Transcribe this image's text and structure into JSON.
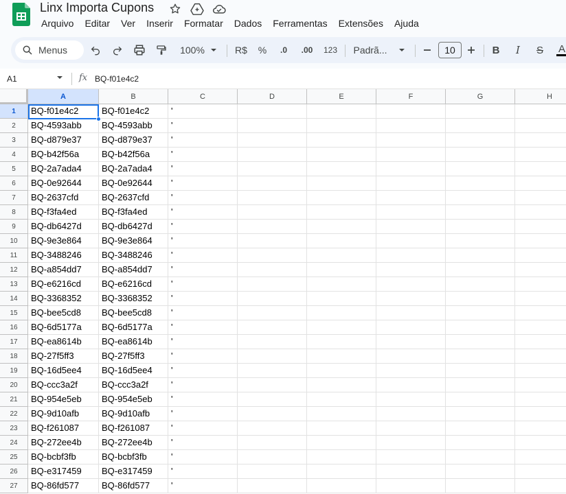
{
  "title": "Linx Importa Cupons",
  "menu": [
    "Arquivo",
    "Editar",
    "Ver",
    "Inserir",
    "Formatar",
    "Dados",
    "Ferramentas",
    "Extensões",
    "Ajuda"
  ],
  "toolbar": {
    "search_label": "Menus",
    "zoom": "100%",
    "currency": "R$",
    "percent": "%",
    "decrease_decimal": ".0",
    "increase_decimal": ".00",
    "number_format": "123",
    "font": "Padrã...",
    "font_size": "10",
    "bold": "B",
    "italic": "I",
    "strike": "S",
    "text_color": "A"
  },
  "formula_bar": {
    "cell_ref": "A1",
    "value": "BQ-f01e4c2"
  },
  "colors": {
    "accent": "#1a73e8",
    "header_selected": "#d3e3fd",
    "sheets_green": "#0f9d58"
  },
  "grid": {
    "columns": [
      "A",
      "B",
      "C",
      "D",
      "E",
      "F",
      "G",
      "H"
    ],
    "selected_cell": "A1",
    "rows": [
      {
        "n": "1",
        "a": "BQ-f01e4c2",
        "b": "BQ-f01e4c2",
        "c": "'"
      },
      {
        "n": "2",
        "a": "BQ-4593abb",
        "b": "BQ-4593abb",
        "c": "'"
      },
      {
        "n": "3",
        "a": "BQ-d879e37",
        "b": "BQ-d879e37",
        "c": "'"
      },
      {
        "n": "4",
        "a": "BQ-b42f56a",
        "b": "BQ-b42f56a",
        "c": "'"
      },
      {
        "n": "5",
        "a": "BQ-2a7ada4",
        "b": "BQ-2a7ada4",
        "c": "'"
      },
      {
        "n": "6",
        "a": "BQ-0e92644",
        "b": "BQ-0e92644",
        "c": "'"
      },
      {
        "n": "7",
        "a": "BQ-2637cfd",
        "b": "BQ-2637cfd",
        "c": "'"
      },
      {
        "n": "8",
        "a": "BQ-f3fa4ed",
        "b": "BQ-f3fa4ed",
        "c": "'"
      },
      {
        "n": "9",
        "a": "BQ-db6427d",
        "b": "BQ-db6427d",
        "c": "'"
      },
      {
        "n": "10",
        "a": "BQ-9e3e864",
        "b": "BQ-9e3e864",
        "c": "'"
      },
      {
        "n": "11",
        "a": "BQ-3488246",
        "b": "BQ-3488246",
        "c": "'"
      },
      {
        "n": "12",
        "a": "BQ-a854dd7",
        "b": "BQ-a854dd7",
        "c": "'"
      },
      {
        "n": "13",
        "a": "BQ-e6216cd",
        "b": "BQ-e6216cd",
        "c": "'"
      },
      {
        "n": "14",
        "a": "BQ-3368352",
        "b": "BQ-3368352",
        "c": "'"
      },
      {
        "n": "15",
        "a": "BQ-bee5cd8",
        "b": "BQ-bee5cd8",
        "c": "'"
      },
      {
        "n": "16",
        "a": "BQ-6d5177a",
        "b": "BQ-6d5177a",
        "c": "'"
      },
      {
        "n": "17",
        "a": "BQ-ea8614b",
        "b": "BQ-ea8614b",
        "c": "'"
      },
      {
        "n": "18",
        "a": "BQ-27f5ff3",
        "b": "BQ-27f5ff3",
        "c": "'"
      },
      {
        "n": "19",
        "a": "BQ-16d5ee4",
        "b": "BQ-16d5ee4",
        "c": "'"
      },
      {
        "n": "20",
        "a": "BQ-ccc3a2f",
        "b": "BQ-ccc3a2f",
        "c": "'"
      },
      {
        "n": "21",
        "a": "BQ-954e5eb",
        "b": "BQ-954e5eb",
        "c": "'"
      },
      {
        "n": "22",
        "a": "BQ-9d10afb",
        "b": "BQ-9d10afb",
        "c": "'"
      },
      {
        "n": "23",
        "a": "BQ-f261087",
        "b": "BQ-f261087",
        "c": "'"
      },
      {
        "n": "24",
        "a": "BQ-272ee4b",
        "b": "BQ-272ee4b",
        "c": "'"
      },
      {
        "n": "25",
        "a": "BQ-bcbf3fb",
        "b": "BQ-bcbf3fb",
        "c": "'"
      },
      {
        "n": "26",
        "a": "BQ-e317459",
        "b": "BQ-e317459",
        "c": "'"
      },
      {
        "n": "27",
        "a": "BQ-86fd577",
        "b": "BQ-86fd577",
        "c": "'"
      }
    ]
  }
}
